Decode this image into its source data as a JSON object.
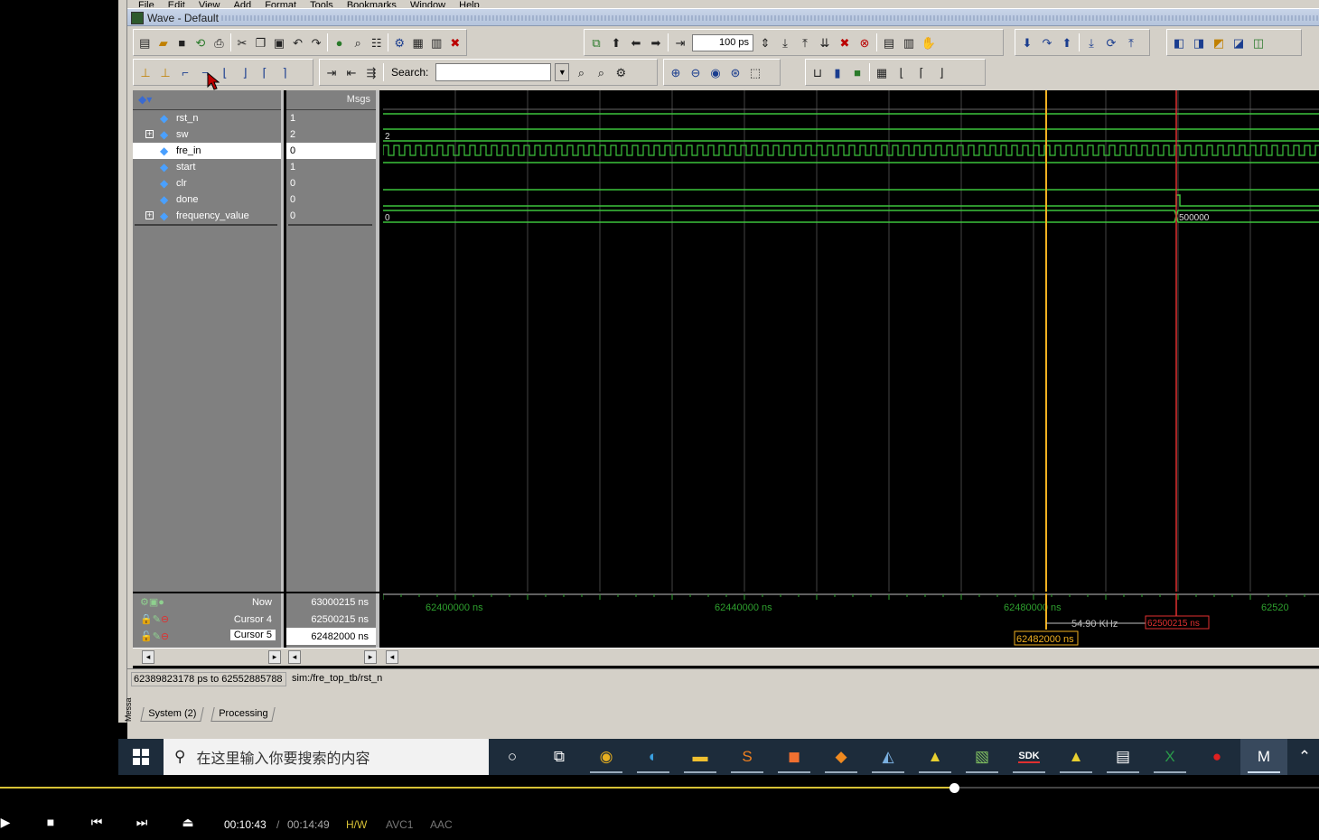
{
  "app": {
    "menu": [
      "File",
      "Edit",
      "View",
      "Add",
      "Format",
      "Tools",
      "Bookmarks",
      "Window",
      "Help"
    ],
    "window_title": "Wave - Default"
  },
  "toolbar": {
    "zoom_value": "100",
    "zoom_unit": "ps",
    "search_label": "Search:",
    "search_value": ""
  },
  "wave": {
    "msgs_header": "Msgs",
    "signals": [
      {
        "name": "rst_n",
        "value": "1",
        "expandable": false
      },
      {
        "name": "sw",
        "value": "2",
        "expandable": true
      },
      {
        "name": "fre_in",
        "value": "0",
        "expandable": false,
        "selected": true
      },
      {
        "name": "start",
        "value": "1",
        "expandable": false
      },
      {
        "name": "clr",
        "value": "0",
        "expandable": false
      },
      {
        "name": "done",
        "value": "0",
        "expandable": false
      },
      {
        "name": "frequency_value",
        "value": "0",
        "expandable": true
      }
    ],
    "trace_labels": {
      "sw": "2",
      "frequency_before": "0",
      "frequency_after": "500000"
    },
    "time_axis": {
      "ticks": [
        "62400000 ns",
        "62440000 ns",
        "62480000 ns",
        "62520"
      ],
      "unit": "ns"
    },
    "cursors": [
      {
        "name": "Now",
        "value": "63000215 ns"
      },
      {
        "name": "Cursor 4",
        "value": "62500215 ns",
        "color": "#e03030"
      },
      {
        "name": "Cursor 5",
        "value": "62482000 ns",
        "color": "#f0b020",
        "selected": true
      }
    ],
    "measure_label": "54.90 KHz",
    "cursor4_tag": "62500215 ns",
    "cursor5_tag": "62482000 ns"
  },
  "status": {
    "range": "62389823178 ps to 62552885788",
    "path": "sim:/fre_top_tb/rst_n"
  },
  "tabs": {
    "vertical_label": "Messa",
    "items": [
      "System (2)",
      "Processing"
    ]
  },
  "taskbar": {
    "search_placeholder": "在这里输入你要搜索的内容",
    "sdk_label": "SDK"
  },
  "player": {
    "current_time": "00:10:43",
    "separator": "/",
    "duration": "00:14:49",
    "hw_tag": "H/W",
    "video_codec": "AVC1",
    "audio_codec": "AAC",
    "progress": 0.7233
  },
  "colors": {
    "trace_green": "#3cc43c",
    "cursor_red": "#e03030",
    "cursor_yellow": "#f0b020",
    "progress_yellow": "#d8c236"
  }
}
